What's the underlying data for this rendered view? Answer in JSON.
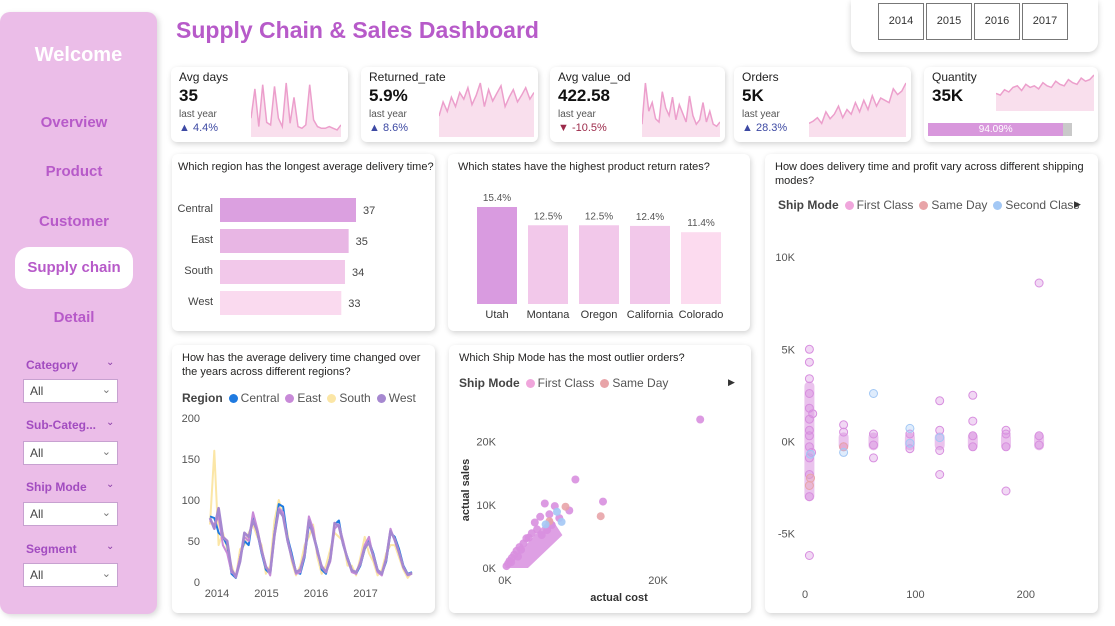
{
  "sidebar": {
    "welcome": "Welcome",
    "nav": [
      "Overview",
      "Product",
      "Customer",
      "Supply chain",
      "Detail"
    ],
    "active_nav": "Supply chain",
    "filters": [
      {
        "label": "Category",
        "value": "All"
      },
      {
        "label": "Sub-Categ...",
        "value": "All"
      },
      {
        "label": "Ship Mode",
        "value": "All"
      },
      {
        "label": "Segment",
        "value": "All"
      }
    ]
  },
  "header": {
    "title": "Supply Chain & Sales Dashboard",
    "years": [
      "2014",
      "2015",
      "2016",
      "2017"
    ]
  },
  "kpis": [
    {
      "label": "Avg days",
      "value": "35",
      "last_year_label": "last year",
      "delta": "4.4%",
      "trend": "up"
    },
    {
      "label": "Returned_rate",
      "value": "5.9%",
      "last_year_label": "last year",
      "delta": "8.6%",
      "trend": "up"
    },
    {
      "label": "Avg value_od",
      "value": "422.58",
      "last_year_label": "last year",
      "delta": "-10.5%",
      "trend": "down"
    },
    {
      "label": "Orders",
      "value": "5K",
      "last_year_label": "last year",
      "delta": "28.3%",
      "trend": "up"
    },
    {
      "label": "Quantity",
      "value": "35K",
      "progress_label": "94.09%",
      "progress": 0.9409
    }
  ],
  "colors": {
    "accent": "#b75ac9",
    "sidebar": "#ebbde8",
    "spark_line": "#ec9fcc",
    "spark_fill": "#f7d1e6",
    "up": "#3d49a3",
    "down": "#9c2a4a"
  },
  "charts": {
    "region": {
      "title": "Which region has the longest average delivery time?"
    },
    "states": {
      "title": "Which states have the highest product return rates?"
    },
    "shipmode_scatter": {
      "title": "How does delivery time and profit vary across different shipping modes?",
      "legend_title": "Ship Mode",
      "legend": [
        "First Class",
        "Same Day",
        "Second Class"
      ]
    },
    "delivery_line": {
      "title": "How has the average delivery time changed over the years across different regions?",
      "legend_title": "Region",
      "legend": [
        "Central",
        "East",
        "South",
        "West"
      ]
    },
    "outlier": {
      "title": "Which Ship Mode has the most outlier orders?",
      "legend_title": "Ship Mode",
      "legend": [
        "First Class",
        "Same Day"
      ]
    }
  },
  "chart_data": [
    {
      "type": "bar",
      "orientation": "horizontal",
      "title": "Which region has the longest average delivery time?",
      "categories": [
        "Central",
        "East",
        "South",
        "West"
      ],
      "values": [
        37,
        35,
        34,
        33
      ],
      "labels": [
        "37",
        "35",
        "34",
        "33"
      ],
      "colors": [
        "#dba0e0",
        "#e8b6e4",
        "#f2c8ea",
        "#fadaef"
      ]
    },
    {
      "type": "bar",
      "title": "Which states have the highest product return rates?",
      "categories": [
        "Utah",
        "Montana",
        "Oregon",
        "California",
        "Colorado"
      ],
      "values": [
        15.4,
        12.5,
        12.5,
        12.4,
        11.4
      ],
      "labels": [
        "15.4%",
        "12.5%",
        "12.5%",
        "12.4%",
        "11.4%"
      ],
      "colors": [
        "#d99be0",
        "#f2c8ea",
        "#f2c8ea",
        "#f2c8ea",
        "#fcdbef"
      ]
    },
    {
      "type": "line",
      "title": "How has the average delivery time changed over the years across different regions?",
      "x_ticks": [
        "2014",
        "2015",
        "2016",
        "2017"
      ],
      "y_ticks": [
        "0",
        "50",
        "100",
        "150",
        "200"
      ],
      "ylim": [
        0,
        200
      ],
      "x_points": 48,
      "series": [
        {
          "name": "Central",
          "color": "#1f7ae0",
          "values": [
            80,
            78,
            60,
            55,
            45,
            10,
            5,
            30,
            50,
            45,
            80,
            60,
            35,
            15,
            10,
            60,
            95,
            92,
            55,
            35,
            12,
            10,
            30,
            70,
            60,
            40,
            15,
            10,
            30,
            70,
            75,
            45,
            30,
            15,
            10,
            20,
            40,
            50,
            35,
            15,
            10,
            25,
            60,
            55,
            40,
            20,
            10,
            12
          ]
        },
        {
          "name": "East",
          "color": "#c88ad8",
          "values": [
            75,
            70,
            80,
            45,
            35,
            12,
            8,
            30,
            55,
            50,
            85,
            65,
            40,
            20,
            8,
            55,
            90,
            85,
            50,
            30,
            10,
            12,
            35,
            80,
            65,
            35,
            20,
            12,
            25,
            65,
            70,
            50,
            28,
            12,
            10,
            25,
            45,
            55,
            30,
            12,
            8,
            30,
            65,
            50,
            35,
            18,
            8,
            10
          ]
        },
        {
          "name": "South",
          "color": "#fbe6a6",
          "values": [
            70,
            160,
            45,
            60,
            40,
            20,
            5,
            40,
            45,
            60,
            70,
            55,
            45,
            10,
            20,
            75,
            100,
            80,
            60,
            25,
            8,
            20,
            45,
            55,
            70,
            30,
            10,
            20,
            40,
            60,
            55,
            50,
            20,
            20,
            8,
            30,
            55,
            35,
            25,
            8,
            15,
            35,
            45,
            45,
            30,
            15,
            5,
            12
          ]
        },
        {
          "name": "West",
          "color": "#a688d0",
          "values": [
            78,
            65,
            90,
            55,
            50,
            15,
            6,
            25,
            60,
            55,
            75,
            62,
            38,
            18,
            12,
            58,
            88,
            80,
            52,
            30,
            12,
            15,
            33,
            75,
            58,
            38,
            18,
            12,
            28,
            72,
            68,
            46,
            28,
            14,
            12,
            22,
            42,
            48,
            32,
            14,
            10,
            28,
            62,
            52,
            36,
            18,
            9,
            11
          ]
        }
      ]
    },
    {
      "type": "scatter",
      "title": "Which Ship Mode has the most outlier orders?",
      "xlabel": "actual cost",
      "ylabel": "actual sales",
      "x_ticks": [
        "0K",
        "20K"
      ],
      "y_ticks": [
        "0K",
        "10K",
        "20K"
      ],
      "xlim": [
        0,
        26000
      ],
      "ylim": [
        0,
        25000
      ],
      "series": [
        {
          "name": "First Class",
          "color": "#d88fdf",
          "points": [
            [
              25500,
              23500
            ],
            [
              9200,
              14000
            ],
            [
              12800,
              10500
            ],
            [
              5200,
              10200
            ],
            [
              6500,
              9800
            ],
            [
              8400,
              9100
            ],
            [
              5800,
              8500
            ],
            [
              4600,
              8100
            ],
            [
              7100,
              7900
            ],
            [
              3900,
              7200
            ],
            [
              6100,
              6800
            ],
            [
              4200,
              6100
            ],
            [
              3500,
              5500
            ],
            [
              2800,
              4700
            ],
            [
              2400,
              3900
            ],
            [
              1900,
              3300
            ],
            [
              1500,
              2700
            ],
            [
              1200,
              2100
            ],
            [
              900,
              1600
            ],
            [
              600,
              1100
            ],
            [
              400,
              700
            ],
            [
              200,
              300
            ],
            [
              3100,
              4800
            ],
            [
              4800,
              5200
            ],
            [
              5500,
              6000
            ],
            [
              2100,
              2900
            ],
            [
              1700,
              1800
            ],
            [
              800,
              900
            ]
          ]
        },
        {
          "name": "Same Day",
          "color": "#e8a4a8",
          "points": [
            [
              12500,
              8200
            ],
            [
              7900,
              9700
            ],
            [
              5800,
              7400
            ]
          ]
        },
        {
          "name": "Second Class",
          "color": "#a3c8f5",
          "points": [
            [
              6800,
              8900
            ],
            [
              7400,
              7300
            ],
            [
              5300,
              6900
            ]
          ]
        }
      ]
    },
    {
      "type": "scatter",
      "title": "How does delivery time and profit vary across different shipping modes?",
      "x_ticks": [
        "0",
        "100",
        "200"
      ],
      "y_ticks": [
        "10K",
        "5K",
        "0K",
        "-5K"
      ],
      "xlim": [
        0,
        240
      ],
      "ylim": [
        -6500,
        10500
      ],
      "series": [
        {
          "name": "First Class",
          "color": "#d88fdf",
          "points": [
            [
              212,
              8600
            ],
            [
              4,
              5000
            ],
            [
              4,
              4300
            ],
            [
              4,
              3400
            ],
            [
              4,
              2600
            ],
            [
              4,
              1800
            ],
            [
              4,
              1200
            ],
            [
              4,
              600
            ],
            [
              4,
              -300
            ],
            [
              4,
              -900
            ],
            [
              4,
              -1800
            ],
            [
              4,
              -3000
            ],
            [
              4,
              -6200
            ],
            [
              7,
              1500
            ],
            [
              6,
              -600
            ],
            [
              35,
              -300
            ],
            [
              35,
              500
            ],
            [
              62,
              400
            ],
            [
              62,
              -200
            ],
            [
              95,
              400
            ],
            [
              95,
              -400
            ],
            [
              122,
              600
            ],
            [
              122,
              -500
            ],
            [
              152,
              300
            ],
            [
              152,
              -300
            ],
            [
              152,
              1100
            ],
            [
              182,
              400
            ],
            [
              182,
              -300
            ],
            [
              182,
              600
            ],
            [
              212,
              300
            ],
            [
              212,
              -200
            ],
            [
              122,
              2200
            ],
            [
              152,
              2500
            ],
            [
              182,
              -2700
            ],
            [
              122,
              -1800
            ],
            [
              62,
              -900
            ],
            [
              35,
              900
            ],
            [
              4,
              300
            ]
          ]
        },
        {
          "name": "Same Day",
          "color": "#e8a4a8",
          "points": [
            [
              4,
              -2400
            ],
            [
              35,
              -300
            ],
            [
              5,
              -2000
            ]
          ]
        },
        {
          "name": "Second Class",
          "color": "#a3c8f5",
          "points": [
            [
              62,
              2600
            ],
            [
              95,
              700
            ],
            [
              95,
              -100
            ],
            [
              122,
              200
            ],
            [
              35,
              -600
            ],
            [
              5,
              -700
            ]
          ]
        }
      ]
    }
  ]
}
